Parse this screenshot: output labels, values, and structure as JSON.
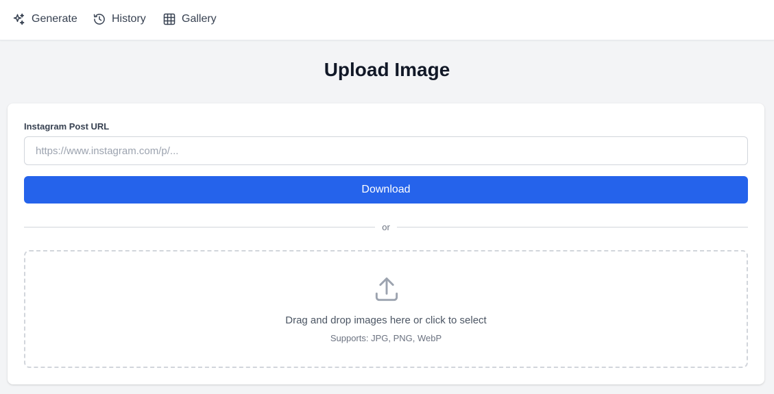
{
  "nav": {
    "items": [
      {
        "label": "Generate",
        "icon": "sparkles-icon"
      },
      {
        "label": "History",
        "icon": "history-icon"
      },
      {
        "label": "Gallery",
        "icon": "grid-icon"
      }
    ]
  },
  "page": {
    "title": "Upload Image"
  },
  "form": {
    "url_label": "Instagram Post URL",
    "url_placeholder": "https://www.instagram.com/p/...",
    "url_value": "",
    "download_label": "Download",
    "divider_text": "or"
  },
  "dropzone": {
    "icon": "upload-icon",
    "text": "Drag and drop images here or click to select",
    "subtext": "Supports: JPG, PNG, WebP"
  },
  "colors": {
    "primary": "#2563eb",
    "background": "#f3f4f6",
    "card": "#ffffff"
  }
}
